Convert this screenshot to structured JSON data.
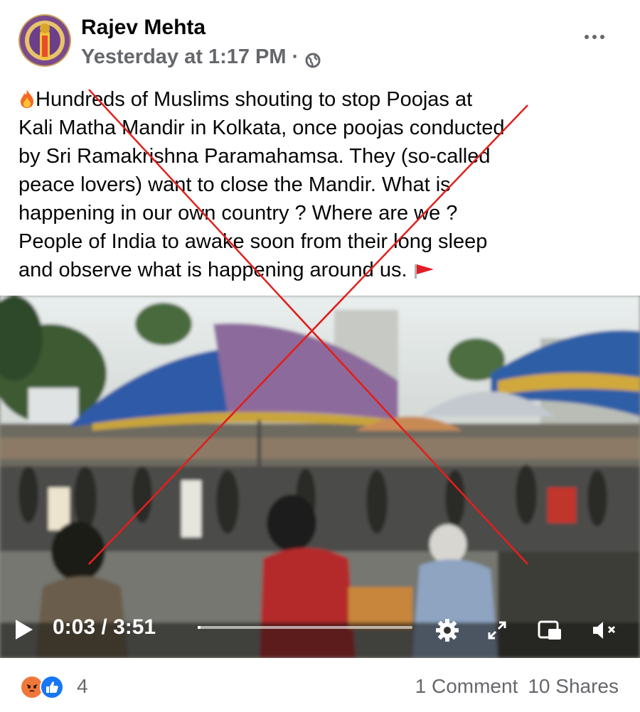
{
  "post": {
    "author": "Rajev Mehta",
    "timestamp": "Yesterday at 1:17 PM",
    "separator": "·",
    "privacy_icon": "globe-icon",
    "more_icon": "more-options-icon",
    "text_lines": [
      "Hundreds of Muslims shouting to stop Poojas at",
      "Kali Matha Mandir in Kolkata, once poojas conducted",
      "by Sri Ramakrishna Paramahamsa. They (so-called",
      "peace lovers) want to close the Mandir. What is",
      "happening in our own country ? Where are we ?",
      "People of India to awake soon from their long sleep",
      "and observe what is happening around us."
    ],
    "leading_emoji": "fire-icon",
    "trailing_emoji": "red-flag-icon"
  },
  "video": {
    "current_time": "0:03",
    "duration": "3:51",
    "time_separator": " / ",
    "progress": 0.013,
    "icons": [
      "play-icon",
      "settings-icon",
      "fullscreen-icon",
      "picture-in-picture-icon",
      "mute-icon"
    ]
  },
  "overlay": {
    "type": "red-cross",
    "color": "#e0201c"
  },
  "footer": {
    "reactions": [
      "angry-icon",
      "like-icon"
    ],
    "reaction_count": "4",
    "comments": "1 Comment",
    "shares": "10 Shares"
  },
  "colors": {
    "text": "#050505",
    "secondary": "#65676b",
    "like_blue": "#1877f2",
    "angry_orange": "#f0773a"
  }
}
